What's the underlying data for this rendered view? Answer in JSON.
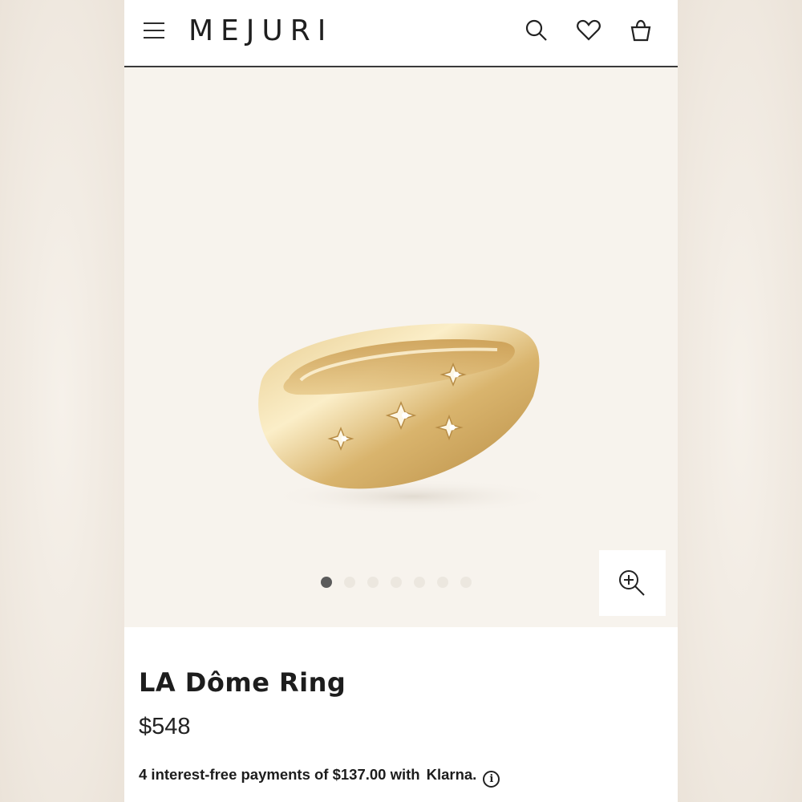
{
  "header": {
    "brand": "MEJURI",
    "icons": [
      "menu-icon",
      "search-icon",
      "heart-icon",
      "bag-icon"
    ]
  },
  "gallery": {
    "image_alt": "LA Dôme Ring",
    "image_count": 7,
    "active_index": 0,
    "zoom_icon": "zoom-in-icon"
  },
  "product": {
    "title": "LA Dôme Ring",
    "price": "$548",
    "installments_text": "4 interest-free payments of $137.00 with",
    "klarna_label": "Klarna.",
    "info_icon": "i"
  },
  "colors": {
    "background": "#f7f3ed",
    "text": "#1d1d1d",
    "gold": "#c9a35a",
    "active_dot": "#5b5b5b"
  }
}
